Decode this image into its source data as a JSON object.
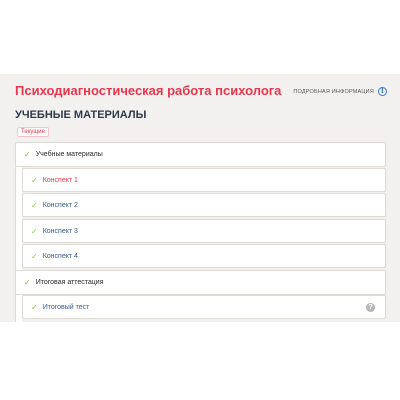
{
  "header": {
    "course_title": "Психодиагностическая работа психолога",
    "more_info_label": "ПОДРОБНАЯ ИНФОРМАЦИЯ",
    "info_icon": "info-icon"
  },
  "section": {
    "title": "УЧЕБНЫЕ МАТЕРИАЛЫ",
    "current_badge": "Текущие"
  },
  "curriculum": {
    "groups": [
      {
        "label": "Учебные материалы",
        "lessons": [
          {
            "label": "Конспект 1",
            "active": true
          },
          {
            "label": "Конспект 2",
            "active": false
          },
          {
            "label": "Конспект 3",
            "active": false
          },
          {
            "label": "Конспект 4",
            "active": false
          }
        ]
      },
      {
        "label": "Итоговая аттестация",
        "lessons": [
          {
            "label": "Итоговый тест",
            "active": false,
            "help_icon": "help-icon"
          }
        ]
      }
    ],
    "check_icon": "check-icon",
    "colors": {
      "accent": "#e8364e",
      "check": "#8cc63f",
      "lesson_text": "#3a5a8a"
    }
  },
  "help_symbol": "?",
  "info_symbol": "i",
  "check_symbol": "✓"
}
